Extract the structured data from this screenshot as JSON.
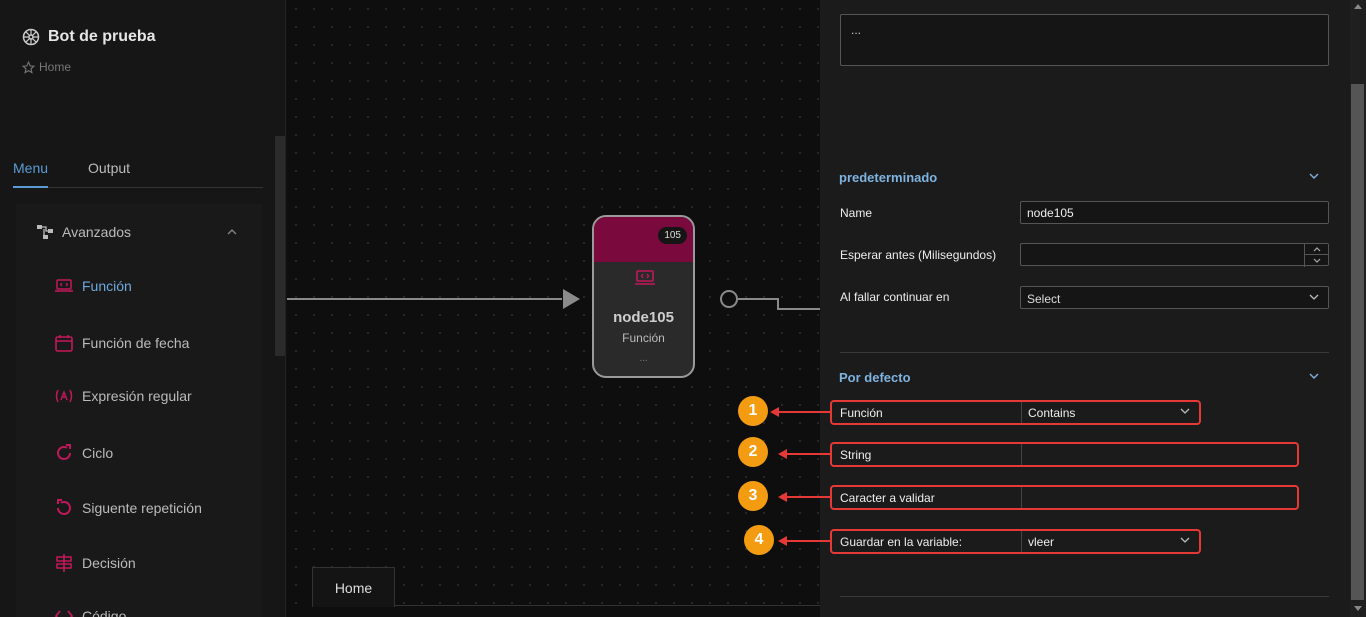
{
  "app": {
    "title": "Bot de prueba",
    "breadcrumb": "Home"
  },
  "sidebar": {
    "tabs": [
      {
        "label": "Menu",
        "active": true
      },
      {
        "label": "Output",
        "active": false
      }
    ],
    "group": {
      "label": "Avanzados",
      "expanded": true
    },
    "items": [
      {
        "label": "Función",
        "icon": "laptop-code-icon",
        "active": true
      },
      {
        "label": "Función de fecha",
        "icon": "calendar-icon"
      },
      {
        "label": "Expresión regular",
        "icon": "regex-icon"
      },
      {
        "label": "Ciclo",
        "icon": "loop-icon"
      },
      {
        "label": "Siguente repetición",
        "icon": "undo-icon"
      },
      {
        "label": "Decisión",
        "icon": "signpost-icon"
      },
      {
        "label": "Código",
        "icon": "code-icon"
      }
    ]
  },
  "canvas": {
    "node": {
      "badge": "105",
      "title": "node105",
      "subtitle": "Función",
      "dots": "..."
    },
    "home_tab": "Home"
  },
  "panel": {
    "description": "...",
    "section1": {
      "title": "predeterminado",
      "name_label": "Name",
      "name_value": "node105",
      "wait_label": "Esperar antes (Milisegundos)",
      "wait_value": "",
      "fail_label": "Al fallar continuar en",
      "fail_value": "Select"
    },
    "section2": {
      "title": "Por defecto",
      "funcion_label": "Función",
      "funcion_value": "Contains",
      "string_label": "String",
      "string_value": "",
      "char_label": "Caracter a validar",
      "char_value": "",
      "var_label": "Guardar en la variable:",
      "var_value": "vleer"
    }
  },
  "annotations": [
    "1",
    "2",
    "3",
    "4"
  ],
  "colors": {
    "accent": "#5b9bd5",
    "node_header": "#7a0a3e",
    "icon_pink": "#c2185b",
    "highlight": "#e53935",
    "badge": "#f39c12"
  }
}
